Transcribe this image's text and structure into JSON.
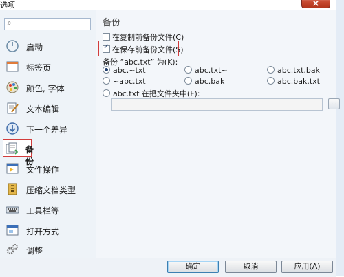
{
  "window": {
    "title": "选项",
    "close_glyph": "×"
  },
  "sidebar": {
    "search_icon": "search-icon",
    "items": [
      {
        "label": "启动",
        "icon": "power-icon"
      },
      {
        "label": "标签页",
        "icon": "tab-page-icon"
      },
      {
        "label": "颜色, 字体",
        "icon": "color-palette-icon"
      },
      {
        "label": "文本编辑",
        "icon": "text-edit-icon"
      },
      {
        "label": "下一个差异",
        "icon": "next-diff-icon"
      },
      {
        "label": "备份",
        "icon": "backup-icon",
        "active": true
      },
      {
        "label": "文件操作",
        "icon": "file-operation-icon"
      },
      {
        "label": "压缩文档类型",
        "icon": "archive-icon"
      },
      {
        "label": "工具栏等",
        "icon": "keyboard-icon"
      },
      {
        "label": "打开方式",
        "icon": "open-with-icon"
      },
      {
        "label": "调整",
        "icon": "gears-icon"
      }
    ]
  },
  "panel": {
    "heading": "备份",
    "backup_before_copy": {
      "label": "在复制前备份文件(C)",
      "checked": false
    },
    "backup_before_save": {
      "label": "在保存前备份文件(S)",
      "checked": true
    },
    "name_group_label": "备份 “abc.txt” 为(K):",
    "options": [
      {
        "label": "abc.~txt",
        "selected": true
      },
      {
        "label": "abc.txt~",
        "selected": false
      },
      {
        "label": "abc.txt.bak",
        "selected": false
      },
      {
        "label": "~abc.txt",
        "selected": false
      },
      {
        "label": "abc.bak",
        "selected": false
      },
      {
        "label": "abc.bak.txt",
        "selected": false
      },
      {
        "label": "abc.txt 在把文件夹中(F):",
        "selected": false
      }
    ],
    "folder_value": "",
    "browse_label": "..."
  },
  "footer": {
    "ok": "确定",
    "cancel": "取消",
    "apply": "应用(A)"
  },
  "colors": {
    "highlight": "#d23c3c",
    "sidebar_bg": "#eef3f8",
    "panel_bg": "#f3f6fa"
  }
}
